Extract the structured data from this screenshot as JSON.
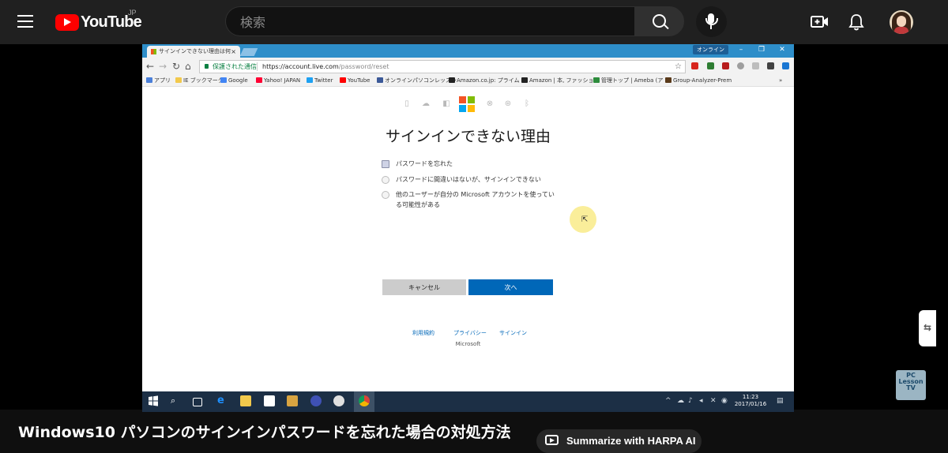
{
  "youtube": {
    "logo_text": "YouTube",
    "region": "JP",
    "search_placeholder": "検索"
  },
  "browser": {
    "tab_title": "サインインできない理由は何",
    "tab_close": "×",
    "online_badge": "オンライン",
    "window_controls": [
      "–",
      "❐",
      "✕"
    ],
    "address_secure_label": "保護された通信",
    "address_url_host": "https://account.live.com",
    "address_url_path": "/password/reset",
    "bookmarks": [
      {
        "label": "アプリ",
        "color": "#4a7fd8"
      },
      {
        "label": "IE ブックマーク",
        "color": "#f2c94c"
      },
      {
        "label": "Google",
        "color": "#4285f4"
      },
      {
        "label": "Yahoo! JAPAN",
        "color": "#ff0033"
      },
      {
        "label": "Twitter",
        "color": "#1da1f2"
      },
      {
        "label": "YouTube",
        "color": "#ff0000"
      },
      {
        "label": "オンラインパソコンレッスン",
        "color": "#3b5998"
      },
      {
        "label": "Amazon.co.jp: プライム",
        "color": "#222222"
      },
      {
        "label": "Amazon | 本, ファッショ",
        "color": "#222222"
      },
      {
        "label": "管理トップ | Ameba (ア",
        "color": "#2d8c3c"
      },
      {
        "label": "Group-Analyzer-Prem",
        "color": "#5a3a1a"
      }
    ],
    "bookmarks_more": "»"
  },
  "page": {
    "title": "サインインできない理由",
    "options": [
      {
        "label": "パスワードを忘れた",
        "selected": true
      },
      {
        "label": "パスワードに間違いはないが、サインインできない",
        "selected": false
      },
      {
        "label_line1": "他のユーザーが自分の Microsoft アカウントを使ってい",
        "label_line2": "る可能性がある",
        "selected": false
      }
    ],
    "cancel_button": "キャンセル",
    "next_button": "次へ",
    "footer_links": [
      "利用規約",
      "プライバシー",
      "サインイン"
    ],
    "footer_brand": "Microsoft",
    "ms_logo_colors": [
      "#f35325",
      "#81bc06",
      "#05a6f0",
      "#ffba08"
    ]
  },
  "taskbar": {
    "time": "11:23",
    "date": "2017/01/16"
  },
  "harpa_handle_glyph": "⇆",
  "watermark_text": "PC Lesson TV",
  "video": {
    "title": "Windows10 パソコンのサインインパスワードを忘れた場合の対処方法",
    "summarize_button": "Summarize with HARPA AI"
  }
}
